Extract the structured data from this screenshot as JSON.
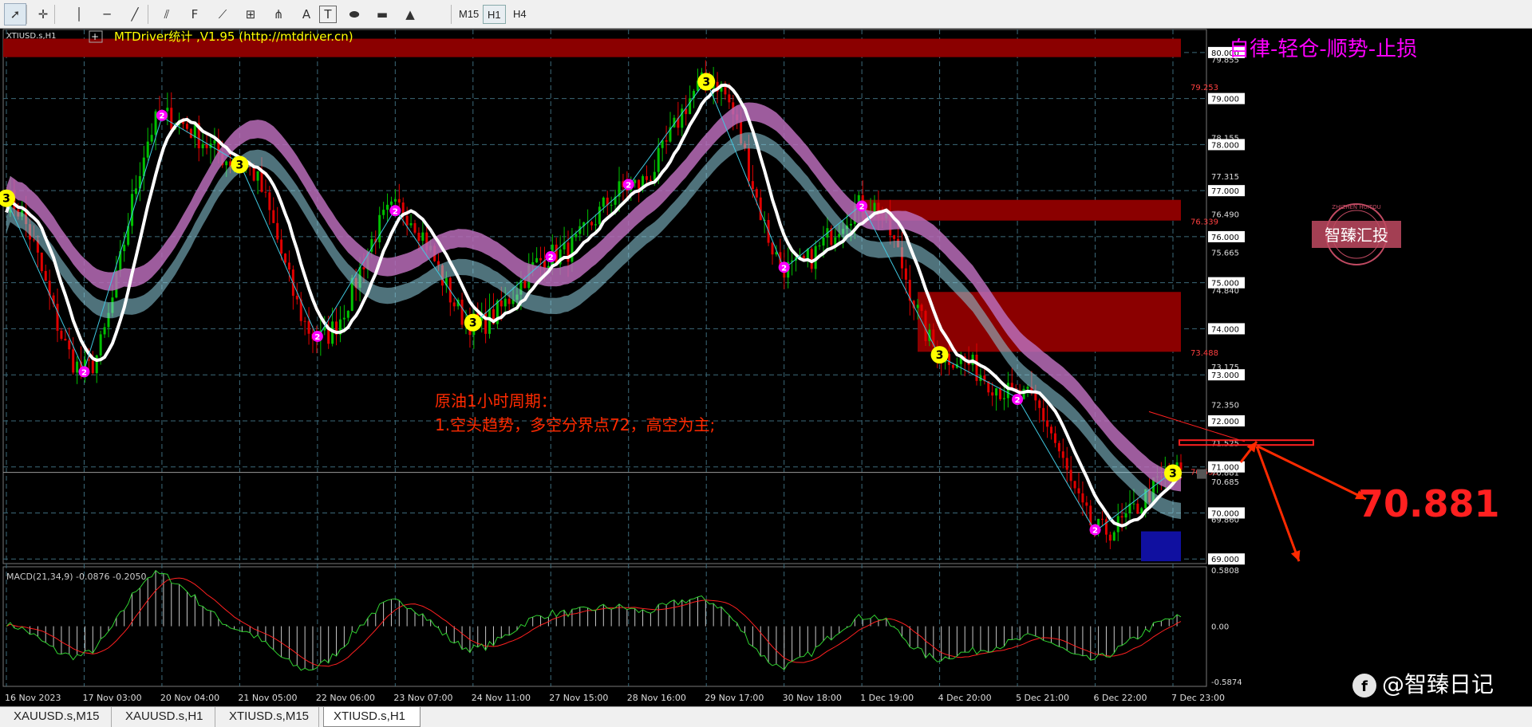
{
  "toolbar": {
    "tools": [
      "cursor-icon",
      "crosshair-icon",
      "vertical-line-icon",
      "horizontal-line-icon",
      "trendline-icon",
      "equidistant-channel-icon",
      "fibonacci-retracement-icon",
      "fibonacci-fan-icon",
      "gann-icon",
      "andrews-pitchfork-icon",
      "text-icon",
      "text-label-icon",
      "ellipse-icon",
      "rectangle-icon",
      "triangle-icon"
    ],
    "timeframes": [
      "M15",
      "H1",
      "H4"
    ],
    "active_timeframe": "H1"
  },
  "chart": {
    "symbol": "XTIUSD.s,H1",
    "indicator_label": "MTDriver统计 ,V1.95 (http://mtdriver.cn)",
    "slogan": "自律-轻仓-顺势-止损",
    "watermark": "智臻汇投",
    "watermark_ring": "ZHIZHEN HUITOU",
    "analysis_line1": "原油1小时周期：",
    "analysis_line2": "1.空头趋势，多空分界点72，高空为主;",
    "target_price": "70.881",
    "current_price": "70.881",
    "zone_labels": [
      "79.253",
      "76.339",
      "73.488",
      "70.555"
    ],
    "credit": "@智臻日记",
    "macd_label": "MACD(21,34,9) -0.0876 -0.2050",
    "colors": {
      "bull": "#00c000",
      "bear": "#e00000",
      "zone": "#8b0000",
      "slogan": "#ff00ff",
      "annotation": "#ff2a00",
      "ribbon": "#b86cb8"
    }
  },
  "price_axis": [
    "80.000",
    "79.855",
    "79.000",
    "78.155",
    "78.000",
    "77.315",
    "77.000",
    "76.490",
    "76.000",
    "75.665",
    "75.000",
    "74.840",
    "74.000",
    "73.175",
    "73.000",
    "72.350",
    "72.000",
    "71.525",
    "71.000",
    "70.881",
    "70.685",
    "70.000",
    "69.860",
    "69.000"
  ],
  "macd_axis": [
    "0.5808",
    "0.00",
    "-0.5874"
  ],
  "time_axis": [
    "16 Nov 2023",
    "17 Nov 03:00",
    "20 Nov 04:00",
    "21 Nov 05:00",
    "22 Nov 06:00",
    "23 Nov 07:00",
    "24 Nov 11:00",
    "27 Nov 15:00",
    "28 Nov 16:00",
    "29 Nov 17:00",
    "30 Nov 18:00",
    "1 Dec 19:00",
    "4 Dec 20:00",
    "5 Dec 21:00",
    "6 Dec 22:00",
    "7 Dec 23:00"
  ],
  "wave_labels": [
    "3",
    "2"
  ],
  "tabs": [
    "XAUUSD.s,M15",
    "XAUUSD.s,H1",
    "XTIUSD.s,M15",
    "XTIUSD.s,H1"
  ],
  "active_tab": "XTIUSD.s,H1",
  "chart_data": {
    "type": "line",
    "x": [
      "16 Nov 2023",
      "17 Nov 03:00",
      "20 Nov 04:00",
      "21 Nov 05:00",
      "22 Nov 06:00",
      "23 Nov 07:00",
      "24 Nov 11:00",
      "27 Nov 15:00",
      "28 Nov 16:00",
      "29 Nov 17:00",
      "30 Nov 18:00",
      "1 Dec 19:00",
      "4 Dec 20:00",
      "5 Dec 21:00",
      "6 Dec 22:00",
      "7 Dec 23:00"
    ],
    "series": [
      {
        "values": [
          76.8,
          73.1,
          78.6,
          77.6,
          73.8,
          76.6,
          74.1,
          75.6,
          77.1,
          79.4,
          75.3,
          76.7,
          73.4,
          72.5,
          69.6,
          70.9
        ]
      }
    ],
    "ylim": [
      69.0,
      80.0
    ],
    "grid": true
  }
}
